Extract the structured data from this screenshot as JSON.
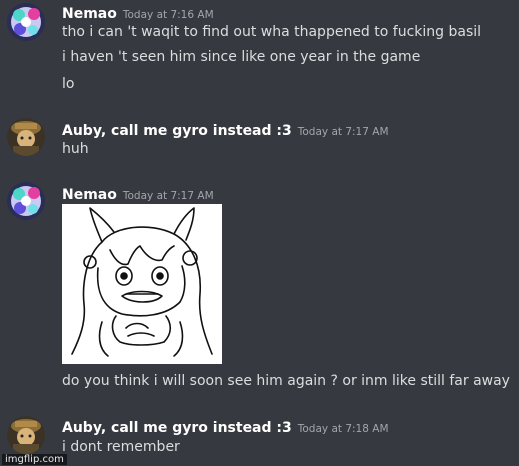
{
  "messages": [
    {
      "username": "Nemao",
      "timestamp": "Today at 7:16 AM",
      "lines": [
        "tho i can 't waqit to find out wha thappened to fucking basil",
        "i haven 't seen him since like one year in the game",
        "lo"
      ]
    },
    {
      "username": "Auby, call me gyro instead :3",
      "timestamp": "Today at 7:17 AM",
      "lines": [
        "huh"
      ]
    },
    {
      "username": "Nemao",
      "timestamp": "Today at 7:17 AM",
      "lines": [
        "do you think i will soon see him again ? or inm like still far away"
      ]
    },
    {
      "username": "Auby, call me gyro instead :3",
      "timestamp": "Today at 7:18 AM",
      "lines": [
        "i dont remember"
      ]
    }
  ],
  "watermark": "imgflip.com",
  "colors": {
    "background": "#36393f",
    "username": "#ffffff",
    "timestamp": "#a3a6aa",
    "text": "#dcddde"
  }
}
